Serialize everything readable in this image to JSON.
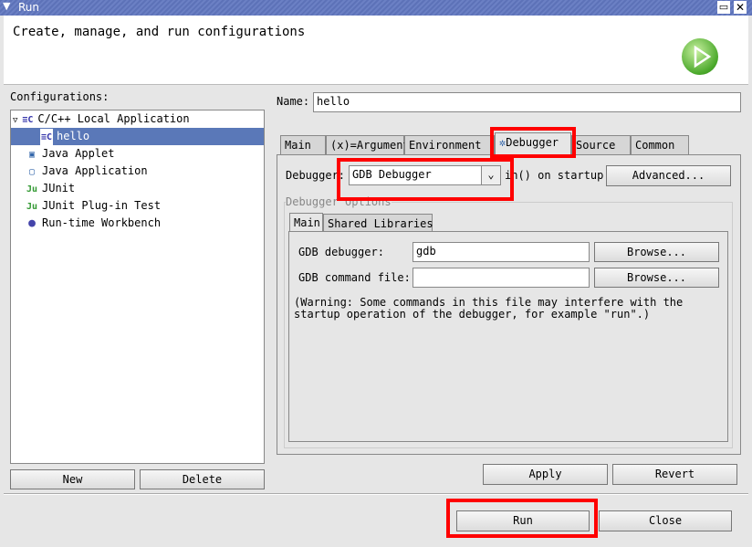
{
  "window": {
    "title": "Run"
  },
  "header": {
    "description": "Create, manage, and run configurations"
  },
  "configurations": {
    "label": "Configurations:",
    "items": [
      {
        "label": "C/C++ Local Application",
        "icon": "c-app-icon"
      },
      {
        "label": "hello",
        "icon": "c-app-icon",
        "selected": true
      },
      {
        "label": "Java Applet",
        "icon": "java-applet-icon"
      },
      {
        "label": "Java Application",
        "icon": "java-app-icon"
      },
      {
        "label": "JUnit",
        "icon": "junit-icon"
      },
      {
        "label": "JUnit Plug-in Test",
        "icon": "junit-plugin-icon"
      },
      {
        "label": "Run-time Workbench",
        "icon": "workbench-icon"
      }
    ],
    "new_label": "New",
    "delete_label": "Delete"
  },
  "name": {
    "label": "Name:",
    "value": "hello"
  },
  "tabs": [
    "Main",
    "(x)=Arguments",
    "Environment",
    "Debugger",
    "Source",
    "Common"
  ],
  "active_tab": "Debugger",
  "debugger": {
    "label": "Debugger:",
    "value": "GDB Debugger",
    "stop_text": "in() on startup",
    "advanced_label": "Advanced...",
    "options_label": "Debugger Options",
    "inner_tabs": [
      "Main",
      "Shared Libraries"
    ],
    "gdb_debugger_label": "GDB debugger:",
    "gdb_debugger_value": "gdb",
    "gdb_command_label": "GDB command file:",
    "gdb_command_value": "",
    "browse_label": "Browse...",
    "warning": "(Warning: Some commands in this file may interfere with the startup operation of the debugger, for example \"run\".)"
  },
  "actions": {
    "apply": "Apply",
    "revert": "Revert",
    "run": "Run",
    "close": "Close"
  },
  "highlight_color": "#ff0000",
  "selection_color": "#5a78b8"
}
